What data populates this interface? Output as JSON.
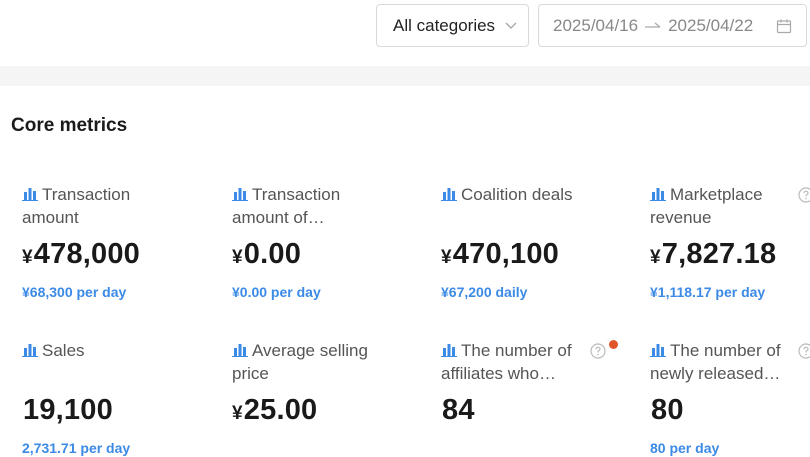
{
  "toolbar": {
    "category_value": "All categories",
    "date_start": "2025/04/16",
    "date_end": "2025/04/22"
  },
  "section": {
    "title": "Core metrics"
  },
  "metrics": [
    {
      "label_line1": "Transaction",
      "label_line2": "amount",
      "currency": "¥",
      "value": "478,000",
      "sub": "¥68,300 per day"
    },
    {
      "label_line1": "Transaction",
      "label_line2": "amount of…",
      "currency": "¥",
      "value": "0.00",
      "sub": "¥0.00 per day"
    },
    {
      "label_line1": "Coalition deals",
      "label_line2": "",
      "currency": "¥",
      "value": "470,100",
      "sub": "¥67,200 daily"
    },
    {
      "label_line1": "Marketplace",
      "label_line2": "revenue",
      "currency": "¥",
      "value": "7,827.18",
      "sub": "¥1,118.17 per day"
    },
    {
      "label_line1": "Sales",
      "label_line2": "",
      "currency": "",
      "value": "19,100",
      "sub": "2,731.71 per day"
    },
    {
      "label_line1": "Average selling",
      "label_line2": "price",
      "currency": "¥",
      "value": "25.00",
      "sub": ""
    },
    {
      "label_line1": "The number of",
      "label_line2": "affiliates who…",
      "currency": "",
      "value": "84",
      "sub": ""
    },
    {
      "label_line1": "The number of",
      "label_line2": "newly released…",
      "currency": "",
      "value": "80",
      "sub": "80 per day"
    }
  ],
  "colors": {
    "accent": "#3b8ae6",
    "notification_dot": "#e0562a",
    "icon_blue": "#3b8ae6"
  },
  "icons": {
    "metric": "bar-chart-icon",
    "help": "question-circle-icon",
    "select": "chevron-down-icon",
    "date_sep": "arrow-right-icon",
    "calendar": "calendar-icon"
  }
}
